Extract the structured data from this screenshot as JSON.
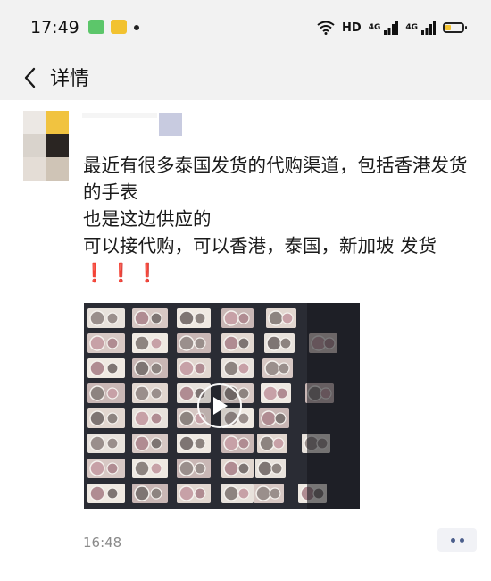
{
  "status_bar": {
    "time": "17:49",
    "network_label": "HD",
    "signal_label_1": "4G",
    "signal_label_2": "4G",
    "battery_level": 0.35,
    "icons": [
      "app-notification-green-icon",
      "app-notification-yellow-icon",
      "wifi-icon",
      "signal-icon",
      "battery-icon"
    ]
  },
  "nav": {
    "title": "详情",
    "back_icon": "chevron-left-icon"
  },
  "post": {
    "lines": [
      "最近有很多泰国发货的代购渠道，包括香港发货的手表",
      "也是这边供应的",
      "可以接代购，可以香港，泰国，新加坡 发货"
    ],
    "exclaim": "❗❗❗",
    "time": "16:48",
    "video_icon": "play-icon",
    "more_icon": "more-dots-icon"
  },
  "colors": {
    "bar_background": "#f2f2f2",
    "accent_dots": "#4c5f8c",
    "exclaim": "#e02b2b"
  }
}
